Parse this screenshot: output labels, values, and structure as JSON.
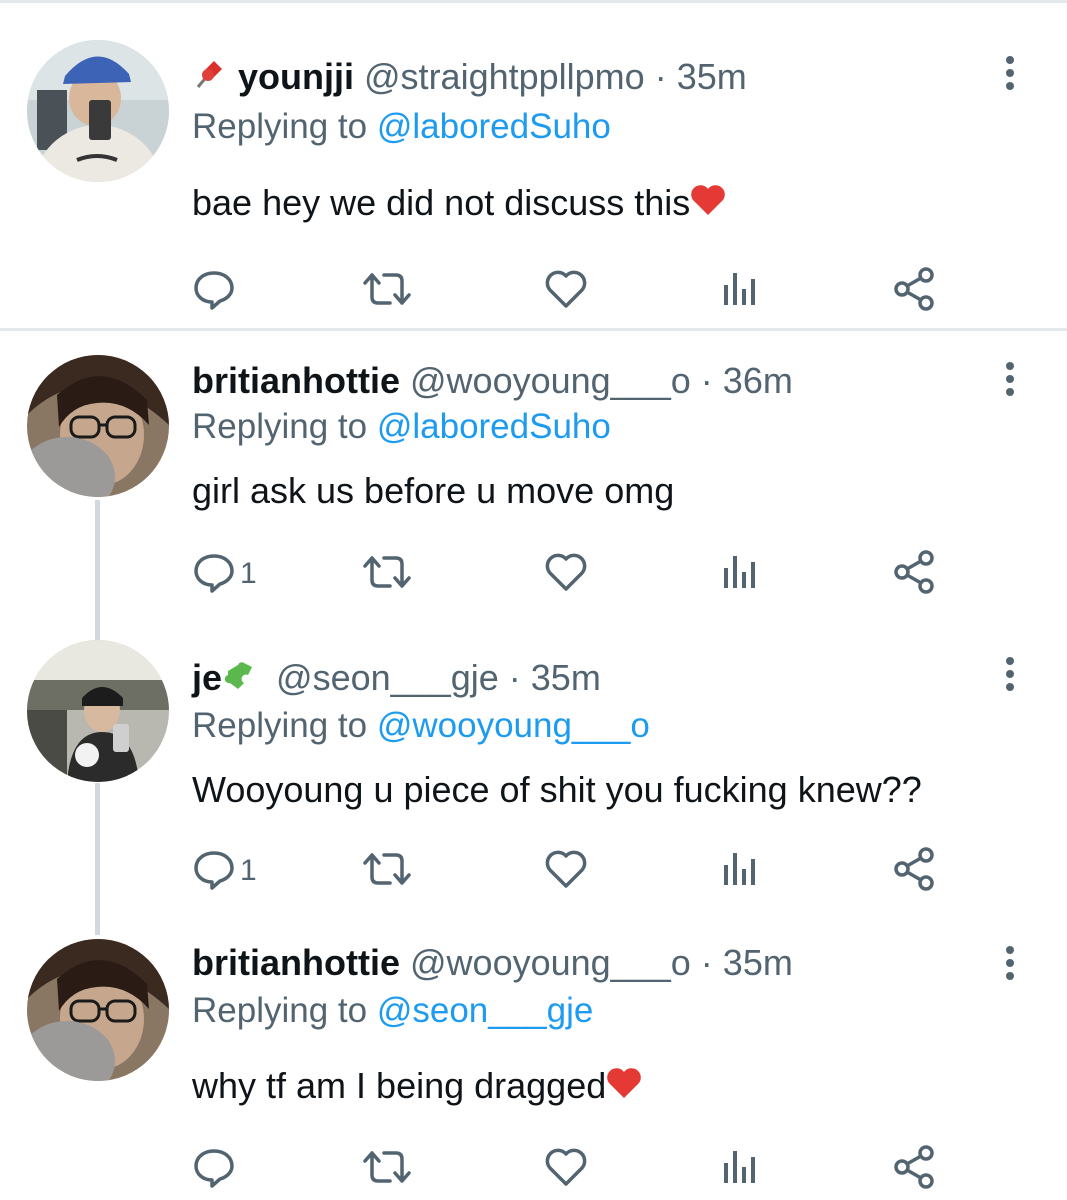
{
  "tweets": [
    {
      "name": "younjji",
      "handle": "@straightppllpmo",
      "dot": "·",
      "time": "35m",
      "replying_prefix": "Replying to ",
      "replying_to": "@laboredSuho",
      "text": "bae hey we did not discuss this",
      "text_emoji": "heart-emoji",
      "reply_count": "",
      "pinned": true
    },
    {
      "name": "britianhottie",
      "handle": "@wooyoung___o",
      "dot": "·",
      "time": "36m",
      "replying_prefix": "Replying to ",
      "replying_to": "@laboredSuho",
      "text": "girl ask us before u move omg",
      "reply_count": "1"
    },
    {
      "name": "je",
      "name_emoji": "puzzle-emoji",
      "handle": "@seon___gje",
      "dot": "·",
      "time": "35m",
      "replying_prefix": "Replying to ",
      "replying_to": "@wooyoung___o",
      "text": "Wooyoung u piece of shit you fucking knew??",
      "reply_count": "1"
    },
    {
      "name": "britianhottie",
      "handle": "@wooyoung___o",
      "dot": "·",
      "time": "35m",
      "replying_prefix": "Replying to ",
      "replying_to": "@seon___gje",
      "text": "why tf am I being dragged",
      "text_emoji": "heart-emoji",
      "reply_count": ""
    }
  ],
  "colors": {
    "text": "#0f1419",
    "muted": "#536471",
    "link": "#1d9bf0",
    "divider": "#e6e9ec",
    "thread_line": "#cfd9de"
  },
  "icons": [
    "reply-icon",
    "retweet-icon",
    "like-icon",
    "views-icon",
    "share-icon",
    "more-icon"
  ]
}
